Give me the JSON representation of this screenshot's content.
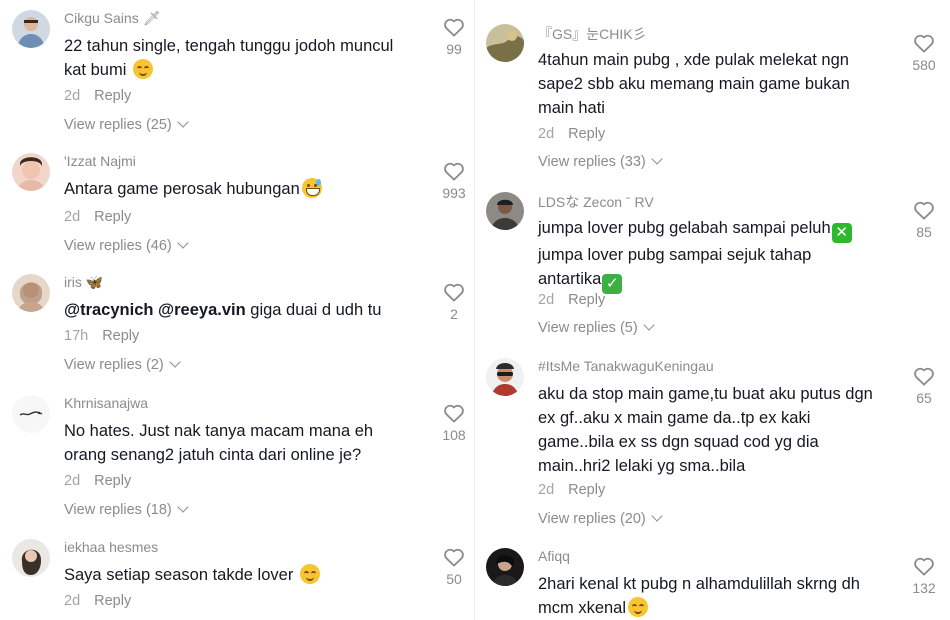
{
  "left_comments": [
    {
      "username": "Cikgu Sains",
      "username_decor": "🗡",
      "text": "22 tahun single, tengah tunggu jodoh muncul\nkat bumi",
      "time": "2d",
      "reply_label": "Reply",
      "view_replies": "View replies (25)",
      "likes": "99",
      "avatar_color": "#6c8fb3"
    },
    {
      "username": "'Izzat Najmi",
      "text": "Antara game perosak hubungan",
      "time": "2d",
      "reply_label": "Reply",
      "view_replies": "View replies (46)",
      "likes": "993",
      "avatar_color": "#e8b9a7"
    },
    {
      "username": "iris",
      "username_decor": "🦋",
      "mention1": "@tracynich",
      "mention2": "@reeya.vin",
      "text": " giga duai d udh tu",
      "time": "17h",
      "reply_label": "Reply",
      "view_replies": "View replies (2)",
      "likes": "2",
      "avatar_color": "#c9a58d"
    },
    {
      "username": "Khrnisanajwa",
      "text": "No hates. Just nak tanya macam mana eh\norang senang2 jatuh cinta dari online je?",
      "time": "2d",
      "reply_label": "Reply",
      "view_replies": "View replies (18)",
      "likes": "108",
      "avatar_color": "#f3f3f3"
    },
    {
      "username": "iekhaa hesmes",
      "text": "Saya setiap season takde lover",
      "time": "2d",
      "reply_label": "Reply",
      "likes": "50",
      "avatar_color": "#d8d4cf"
    }
  ],
  "right_comments": [
    {
      "username": "『GS』눈CHIK彡",
      "text": "4tahun main pubg , xde pulak melekat ngn\nsape2 sbb aku memang main game bukan\nmain hati",
      "time": "2d",
      "reply_label": "Reply",
      "view_replies": "View replies (33)",
      "likes": "580",
      "avatar_color": "#7a7048"
    },
    {
      "username": "LDSな Zecon ˉ RV",
      "text": "jumpa lover pubg gelabah sampai peluh",
      "text2": "jumpa lover pubg sampai sejuk tahap\nantartika",
      "time": "2d",
      "reply_label": "Reply",
      "view_replies": "View replies (5)",
      "likes": "85",
      "avatar_color": "#5a5550"
    },
    {
      "username": "#ItsMe TanakwaguKeningau",
      "text": "aku da stop main game,tu buat aku putus dgn\nex gf..aku x main game da..tp ex kaki\ngame..bila ex ss dgn squad cod yg dia\nmain..hri2 lelaki yg sma..bila",
      "time": "2d",
      "reply_label": "Reply",
      "view_replies": "View replies (20)",
      "likes": "65",
      "avatar_color": "#e6e6e6"
    },
    {
      "username": "Afiqq",
      "text": "2hari kenal kt pubg n alhamdulillah skrng dh\nmcm xkenal",
      "likes": "132",
      "avatar_color": "#2c2a2a"
    }
  ],
  "icons": {
    "like": "heart-outline-icon",
    "expand": "chevron-down-icon"
  }
}
